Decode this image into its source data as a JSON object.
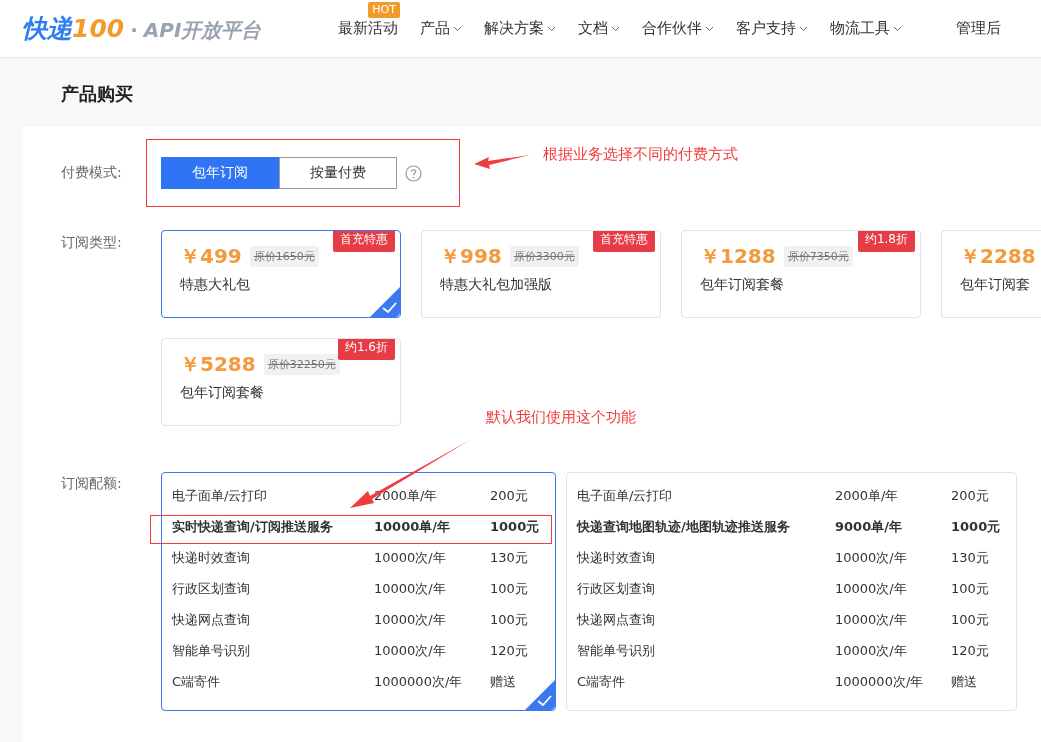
{
  "logo": {
    "brand": "快递",
    "digits": "100",
    "dot": "·",
    "platform": "API开放平台"
  },
  "nav": [
    {
      "label": "最新活动",
      "caret": false,
      "badge": "HOT"
    },
    {
      "label": "产品",
      "caret": true
    },
    {
      "label": "解决方案",
      "caret": true
    },
    {
      "label": "文档",
      "caret": true
    },
    {
      "label": "合作伙伴",
      "caret": true
    },
    {
      "label": "客户支持",
      "caret": true
    },
    {
      "label": "物流工具",
      "caret": true
    },
    {
      "label": "管理后",
      "caret": false
    }
  ],
  "page_title": "产品购买",
  "payment_mode": {
    "label": "付费模式:",
    "tabs": [
      {
        "label": "包年订阅",
        "selected": true
      },
      {
        "label": "按量付费",
        "selected": false
      }
    ]
  },
  "subscription_type": {
    "label": "订阅类型:",
    "plans": [
      {
        "price": "￥499",
        "original_price": "原价1650元",
        "name": "特惠大礼包",
        "badge": "首充特惠",
        "selected": true
      },
      {
        "price": "￥998",
        "original_price": "原价3300元",
        "name": "特惠大礼包加强版",
        "badge": "首充特惠",
        "selected": false
      },
      {
        "price": "￥1288",
        "original_price": "原价7350元",
        "name": "包年订阅套餐",
        "badge": "约1.8折",
        "selected": false
      },
      {
        "price": "￥2288",
        "name": "包年订阅套",
        "selected": false
      },
      {
        "price": "￥5288",
        "original_price": "原价32250元",
        "name": "包年订阅套餐",
        "badge": "约1.6折",
        "selected": false
      }
    ]
  },
  "quota": {
    "label": "订阅配额:",
    "tables": [
      {
        "selected": true,
        "rows": [
          {
            "service": "电子面单/云打印",
            "amount": "2000单/年",
            "price": "200元",
            "highlighted": false
          },
          {
            "service": "实时快递查询/订阅推送服务",
            "amount": "10000单/年",
            "price": "1000元",
            "highlighted": true
          },
          {
            "service": "快递时效查询",
            "amount": "10000次/年",
            "price": "130元",
            "highlighted": false
          },
          {
            "service": "行政区划查询",
            "amount": "10000次/年",
            "price": "100元",
            "highlighted": false
          },
          {
            "service": "快递网点查询",
            "amount": "10000次/年",
            "price": "100元",
            "highlighted": false
          },
          {
            "service": "智能单号识别",
            "amount": "10000次/年",
            "price": "120元",
            "highlighted": false
          },
          {
            "service": "C端寄件",
            "amount": "1000000次/年",
            "price": "赠送",
            "highlighted": false
          }
        ]
      },
      {
        "selected": false,
        "rows": [
          {
            "service": "电子面单/云打印",
            "amount": "2000单/年",
            "price": "200元",
            "highlighted": false
          },
          {
            "service": "快递查询地图轨迹/地图轨迹推送服务",
            "amount": "9000单/年",
            "price": "1000元",
            "highlighted": true
          },
          {
            "service": "快递时效查询",
            "amount": "10000次/年",
            "price": "130元",
            "highlighted": false
          },
          {
            "service": "行政区划查询",
            "amount": "10000次/年",
            "price": "100元",
            "highlighted": false
          },
          {
            "service": "快递网点查询",
            "amount": "10000次/年",
            "price": "100元",
            "highlighted": false
          },
          {
            "service": "智能单号识别",
            "amount": "10000次/年",
            "price": "120元",
            "highlighted": false
          },
          {
            "service": "C端寄件",
            "amount": "1000000次/年",
            "price": "赠送",
            "highlighted": false
          }
        ]
      }
    ]
  },
  "annotations": [
    {
      "text": "根据业务选择不同的付费方式"
    },
    {
      "text": "默认我们使用这个功能"
    }
  ]
}
